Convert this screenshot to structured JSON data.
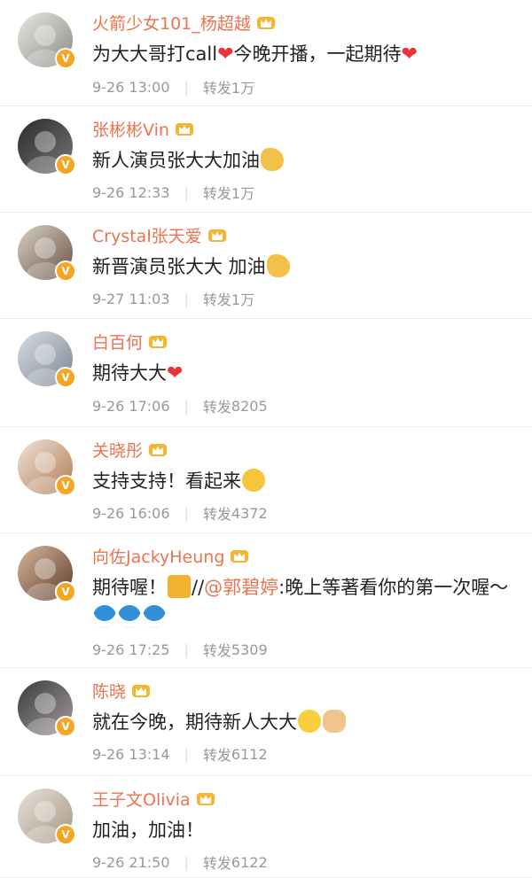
{
  "colors": {
    "name": "#eb7350",
    "verified": "#f4a521",
    "heart": "#e8333b"
  },
  "repost_label": "转发",
  "comments": [
    {
      "name": "火箭少女101_杨超越",
      "segments": [
        {
          "t": "text",
          "v": "为大大哥打call"
        },
        {
          "t": "icon",
          "name": "heart",
          "glyph": "❤"
        },
        {
          "t": "text",
          "v": "今晚开播，一起期待"
        },
        {
          "t": "icon",
          "name": "heart",
          "glyph": "❤"
        }
      ],
      "time": "9-26 13:00",
      "reposts": "1万"
    },
    {
      "name": "张彬彬Vin",
      "segments": [
        {
          "t": "text",
          "v": "新人演员张大大加油"
        },
        {
          "t": "icon",
          "name": "muscle",
          "glyph": ""
        }
      ],
      "time": "9-26 12:33",
      "reposts": "1万"
    },
    {
      "name": "Crystal张天爱",
      "segments": [
        {
          "t": "text",
          "v": "新晋演员张大大 加油"
        },
        {
          "t": "icon",
          "name": "muscle",
          "glyph": ""
        }
      ],
      "time": "9-27 11:03",
      "reposts": "1万"
    },
    {
      "name": "白百何",
      "segments": [
        {
          "t": "text",
          "v": "期待大大"
        },
        {
          "t": "icon",
          "name": "heart",
          "glyph": "❤"
        }
      ],
      "time": "9-26 17:06",
      "reposts": "8205"
    },
    {
      "name": "关晓彤",
      "segments": [
        {
          "t": "text",
          "v": "支持支持！看起来"
        },
        {
          "t": "icon",
          "name": "scream",
          "glyph": ""
        }
      ],
      "time": "9-26 16:06",
      "reposts": "4372"
    },
    {
      "name": "向佐JackyHeung",
      "segments": [
        {
          "t": "text",
          "v": "期待喔！"
        },
        {
          "t": "icon",
          "name": "beer",
          "glyph": ""
        },
        {
          "t": "text",
          "v": "//"
        },
        {
          "t": "mention",
          "v": "@郭碧婷"
        },
        {
          "t": "text",
          "v": ":晚上等著看你的第一次喔～"
        },
        {
          "t": "icon",
          "name": "dora",
          "glyph": ""
        },
        {
          "t": "icon",
          "name": "dora",
          "glyph": ""
        },
        {
          "t": "icon",
          "name": "dora",
          "glyph": ""
        }
      ],
      "time": "9-26 17:25",
      "reposts": "5309"
    },
    {
      "name": "陈晓",
      "segments": [
        {
          "t": "text",
          "v": "就在今晚，期待新人大大"
        },
        {
          "t": "icon",
          "name": "laugh",
          "glyph": ""
        },
        {
          "t": "icon",
          "name": "thumb",
          "glyph": ""
        }
      ],
      "time": "9-26 13:14",
      "reposts": "6112"
    },
    {
      "name": "王子文Olivia",
      "segments": [
        {
          "t": "text",
          "v": "加油，加油！"
        }
      ],
      "time": "9-26 21:50",
      "reposts": "6122"
    }
  ]
}
